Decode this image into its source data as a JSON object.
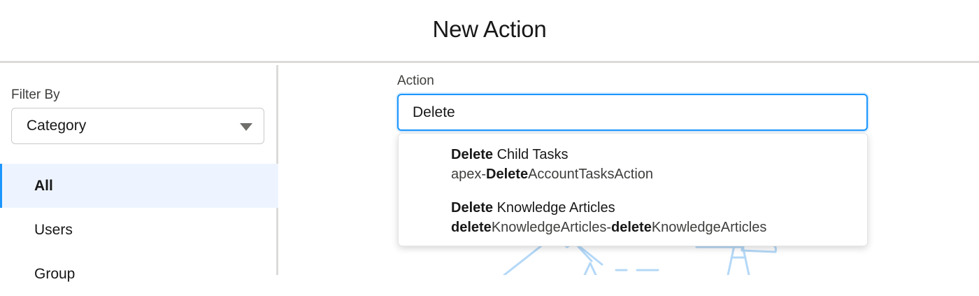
{
  "modal": {
    "title": "New Action"
  },
  "sidebar": {
    "filter_label": "Filter By",
    "filter_value": "Category",
    "items": [
      {
        "label": "All",
        "active": true
      },
      {
        "label": "Users",
        "active": false
      },
      {
        "label": "Group",
        "active": false
      }
    ]
  },
  "action": {
    "label": "Action",
    "input_value": "Delete"
  },
  "dropdown": {
    "options": [
      {
        "title_match": "Delete",
        "title_rest": " Child Tasks",
        "sub_pre": "apex-",
        "sub_match": "Delete",
        "sub_rest": "AccountTasksAction"
      },
      {
        "title_match": "Delete",
        "title_rest": " Knowledge Articles",
        "sub_match1": "delete",
        "sub_mid": "KnowledgeArticles-",
        "sub_match2": "delete",
        "sub_rest": "KnowledgeArticles"
      }
    ]
  },
  "colors": {
    "accent": "#1b96ff",
    "active_bg": "#eef4ff",
    "border": "#dddbda",
    "illustration": "#b4d8f7"
  }
}
